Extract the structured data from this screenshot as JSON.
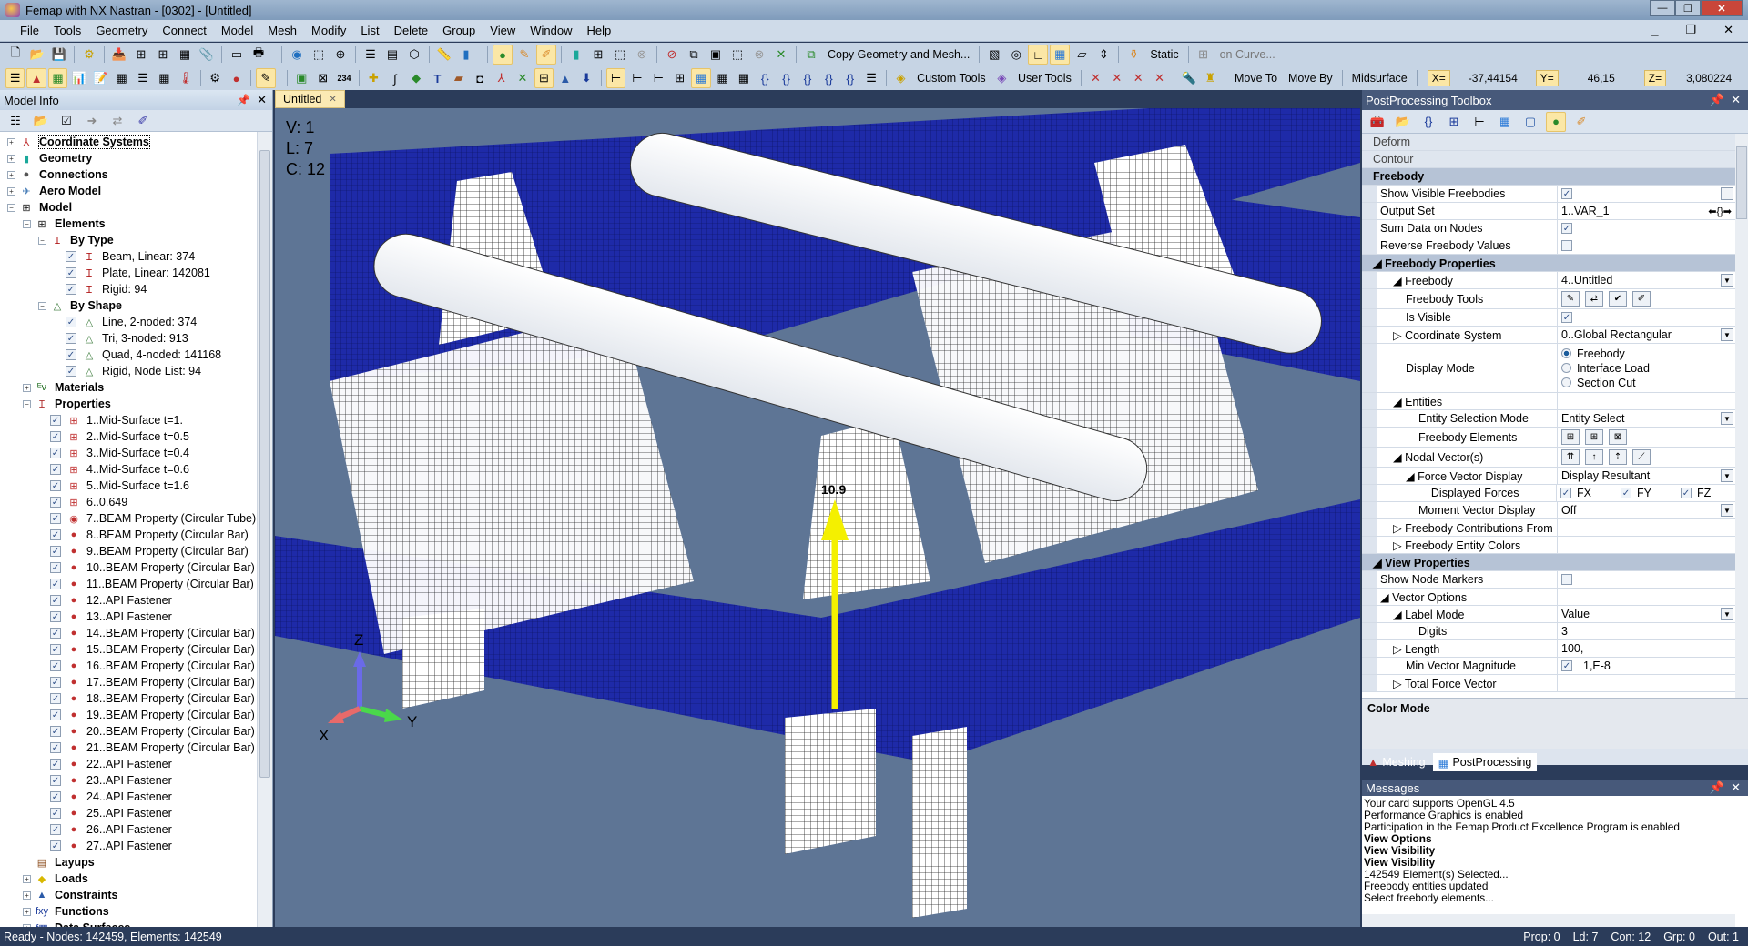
{
  "window": {
    "title": "Femap with NX Nastran - [0302] - [Untitled]",
    "min": "—",
    "restore": "❐",
    "close": "✕"
  },
  "menu": [
    "File",
    "Tools",
    "Geometry",
    "Connect",
    "Model",
    "Mesh",
    "Modify",
    "List",
    "Delete",
    "Group",
    "View",
    "Window",
    "Help"
  ],
  "toolbar": {
    "copy_geometry": "Copy Geometry and Mesh...",
    "static": "Static",
    "on_curve": "on Curve...",
    "custom_tools": "Custom Tools",
    "user_tools": "User Tools",
    "move_to": "Move To",
    "move_by": "Move By",
    "midsurface": "Midsurface",
    "x_label": "X=",
    "x_value": "-37,44154",
    "y_label": "Y=",
    "y_value": "46,15",
    "z_label": "Z=",
    "z_value": "3,080224"
  },
  "model_info": {
    "title": "Model Info",
    "tree": [
      {
        "label": "Coordinate Systems",
        "level": 0,
        "bold": true,
        "exp": "+",
        "icon": "coord-sys-icon",
        "glyph": "⅄",
        "color": "#c03030"
      },
      {
        "label": "Geometry",
        "level": 0,
        "bold": true,
        "exp": "+",
        "icon": "geometry-icon",
        "glyph": "▮",
        "color": "#1aa89a"
      },
      {
        "label": "Connections",
        "level": 0,
        "bold": true,
        "exp": "+",
        "icon": "connections-icon",
        "glyph": "●",
        "color": "#555"
      },
      {
        "label": "Aero Model",
        "level": 0,
        "bold": true,
        "exp": "+",
        "icon": "aero-icon",
        "glyph": "✈",
        "color": "#4a7fb8"
      },
      {
        "label": "Model",
        "level": 0,
        "bold": true,
        "exp": "−",
        "icon": "model-icon",
        "glyph": "⊞",
        "color": "#222"
      },
      {
        "label": "Elements",
        "level": 1,
        "bold": true,
        "exp": "−",
        "icon": "elements-icon",
        "glyph": "⊞",
        "color": "#222"
      },
      {
        "label": "By Type",
        "level": 2,
        "bold": true,
        "exp": "−",
        "icon": "by-type-icon",
        "glyph": "Ｉ",
        "color": "#b01818"
      },
      {
        "label": "Beam, Linear: 374",
        "level": 3,
        "check": true,
        "icon": "beam-icon",
        "glyph": "Ｉ",
        "color": "#b01818"
      },
      {
        "label": "Plate, Linear: 142081",
        "level": 3,
        "check": true,
        "icon": "plate-icon",
        "glyph": "Ｉ",
        "color": "#b01818"
      },
      {
        "label": "Rigid: 94",
        "level": 3,
        "check": true,
        "icon": "rigid-icon",
        "glyph": "Ｉ",
        "color": "#b01818"
      },
      {
        "label": "By Shape",
        "level": 2,
        "bold": true,
        "exp": "−",
        "icon": "by-shape-icon",
        "glyph": "△",
        "color": "#3a7a3a"
      },
      {
        "label": "Line, 2-noded: 374",
        "level": 3,
        "check": true,
        "icon": "shape-icon",
        "glyph": "△",
        "color": "#3a7a3a"
      },
      {
        "label": "Tri,  3-noded: 913",
        "level": 3,
        "check": true,
        "icon": "shape-icon",
        "glyph": "△",
        "color": "#3a7a3a"
      },
      {
        "label": "Quad, 4-noded: 141168",
        "level": 3,
        "check": true,
        "icon": "shape-icon",
        "glyph": "△",
        "color": "#3a7a3a"
      },
      {
        "label": "Rigid, Node List: 94",
        "level": 3,
        "check": true,
        "icon": "shape-icon",
        "glyph": "△",
        "color": "#3a7a3a"
      },
      {
        "label": "Materials",
        "level": 1,
        "bold": true,
        "exp": "+",
        "icon": "materials-icon",
        "glyph": "ᴱν",
        "color": "#1a6a1a"
      },
      {
        "label": "Properties",
        "level": 1,
        "bold": true,
        "exp": "−",
        "icon": "properties-icon",
        "glyph": "Ｉ",
        "color": "#b03030"
      },
      {
        "label": "1..Mid-Surface t=1.",
        "level": 2,
        "check": true,
        "icon": "plate-prop-icon",
        "glyph": "⊞",
        "color": "#c03030"
      },
      {
        "label": "2..Mid-Surface t=0.5",
        "level": 2,
        "check": true,
        "icon": "plate-prop-icon",
        "glyph": "⊞",
        "color": "#c03030"
      },
      {
        "label": "3..Mid-Surface t=0.4",
        "level": 2,
        "check": true,
        "icon": "plate-prop-icon",
        "glyph": "⊞",
        "color": "#c03030"
      },
      {
        "label": "4..Mid-Surface t=0.6",
        "level": 2,
        "check": true,
        "icon": "plate-prop-icon",
        "glyph": "⊞",
        "color": "#c03030"
      },
      {
        "label": "5..Mid-Surface t=1.6",
        "level": 2,
        "check": true,
        "icon": "plate-prop-icon",
        "glyph": "⊞",
        "color": "#c03030"
      },
      {
        "label": "6..0.649",
        "level": 2,
        "check": true,
        "icon": "plate-prop-icon",
        "glyph": "⊞",
        "color": "#c03030"
      },
      {
        "label": "7..BEAM Property (Circular Tube)",
        "level": 2,
        "check": true,
        "icon": "tube-prop-icon",
        "glyph": "◉",
        "color": "#c03030"
      },
      {
        "label": "8..BEAM Property (Circular Bar)",
        "level": 2,
        "check": true,
        "icon": "bar-prop-icon",
        "glyph": "●",
        "color": "#c03030"
      },
      {
        "label": "9..BEAM Property (Circular Bar)",
        "level": 2,
        "check": true,
        "icon": "bar-prop-icon",
        "glyph": "●",
        "color": "#c03030"
      },
      {
        "label": "10..BEAM Property (Circular Bar)",
        "level": 2,
        "check": true,
        "icon": "bar-prop-icon",
        "glyph": "●",
        "color": "#c03030"
      },
      {
        "label": "11..BEAM Property (Circular Bar)",
        "level": 2,
        "check": true,
        "icon": "bar-prop-icon",
        "glyph": "●",
        "color": "#c03030"
      },
      {
        "label": "12..API Fastener",
        "level": 2,
        "check": true,
        "icon": "bar-prop-icon",
        "glyph": "●",
        "color": "#c03030"
      },
      {
        "label": "13..API Fastener",
        "level": 2,
        "check": true,
        "icon": "bar-prop-icon",
        "glyph": "●",
        "color": "#c03030"
      },
      {
        "label": "14..BEAM Property (Circular Bar)",
        "level": 2,
        "check": true,
        "icon": "bar-prop-icon",
        "glyph": "●",
        "color": "#c03030"
      },
      {
        "label": "15..BEAM Property (Circular Bar)",
        "level": 2,
        "check": true,
        "icon": "bar-prop-icon",
        "glyph": "●",
        "color": "#c03030"
      },
      {
        "label": "16..BEAM Property (Circular Bar)",
        "level": 2,
        "check": true,
        "icon": "bar-prop-icon",
        "glyph": "●",
        "color": "#c03030"
      },
      {
        "label": "17..BEAM Property (Circular Bar)",
        "level": 2,
        "check": true,
        "icon": "bar-prop-icon",
        "glyph": "●",
        "color": "#c03030"
      },
      {
        "label": "18..BEAM Property (Circular Bar)",
        "level": 2,
        "check": true,
        "icon": "bar-prop-icon",
        "glyph": "●",
        "color": "#c03030"
      },
      {
        "label": "19..BEAM Property (Circular Bar)",
        "level": 2,
        "check": true,
        "icon": "bar-prop-icon",
        "glyph": "●",
        "color": "#c03030"
      },
      {
        "label": "20..BEAM Property (Circular Bar)",
        "level": 2,
        "check": true,
        "icon": "bar-prop-icon",
        "glyph": "●",
        "color": "#c03030"
      },
      {
        "label": "21..BEAM Property (Circular Bar)",
        "level": 2,
        "check": true,
        "icon": "bar-prop-icon",
        "glyph": "●",
        "color": "#c03030"
      },
      {
        "label": "22..API Fastener",
        "level": 2,
        "check": true,
        "icon": "bar-prop-icon",
        "glyph": "●",
        "color": "#c03030"
      },
      {
        "label": "23..API Fastener",
        "level": 2,
        "check": true,
        "icon": "bar-prop-icon",
        "glyph": "●",
        "color": "#c03030"
      },
      {
        "label": "24..API Fastener",
        "level": 2,
        "check": true,
        "icon": "bar-prop-icon",
        "glyph": "●",
        "color": "#c03030"
      },
      {
        "label": "25..API Fastener",
        "level": 2,
        "check": true,
        "icon": "bar-prop-icon",
        "glyph": "●",
        "color": "#c03030"
      },
      {
        "label": "26..API Fastener",
        "level": 2,
        "check": true,
        "icon": "bar-prop-icon",
        "glyph": "●",
        "color": "#c03030"
      },
      {
        "label": "27..API Fastener",
        "level": 2,
        "check": true,
        "icon": "bar-prop-icon",
        "glyph": "●",
        "color": "#c03030"
      },
      {
        "label": "Layups",
        "level": 1,
        "bold": true,
        "icon": "layups-icon",
        "glyph": "▤",
        "color": "#8a4a1a"
      },
      {
        "label": "Loads",
        "level": 1,
        "bold": true,
        "exp": "+",
        "icon": "loads-icon",
        "glyph": "◆",
        "color": "#d8b800"
      },
      {
        "label": "Constraints",
        "level": 1,
        "bold": true,
        "exp": "+",
        "icon": "constraints-icon",
        "glyph": "▲",
        "color": "#2a5aa8"
      },
      {
        "label": "Functions",
        "level": 1,
        "bold": true,
        "exp": "+",
        "icon": "functions-icon",
        "glyph": "fxy",
        "color": "#1a3a9a"
      },
      {
        "label": "Data Surfaces",
        "level": 1,
        "bold": true,
        "exp": "+",
        "icon": "data-surfaces-icon",
        "glyph": "f▦",
        "color": "#1a3a9a"
      }
    ]
  },
  "viewport": {
    "tab": "Untitled",
    "info": [
      "V: 1",
      "L: 7",
      "C: 12"
    ],
    "axes": {
      "x": "X",
      "y": "Y",
      "z": "Z"
    },
    "vector_label": "10.9"
  },
  "postprocessing": {
    "title": "PostProcessing Toolbox",
    "rows": [
      {
        "type": "cat",
        "name": "Deform"
      },
      {
        "type": "cat",
        "name": "Contour"
      },
      {
        "type": "sect",
        "name": "Freebody"
      },
      {
        "name": "Show Visible Freebodies",
        "indent": 0,
        "check": true,
        "extra": "..."
      },
      {
        "name": "Output Set",
        "indent": 0,
        "value": "1..VAR_1",
        "extra": "arrows"
      },
      {
        "name": "Sum Data on Nodes",
        "indent": 0,
        "check": true
      },
      {
        "name": "Reverse Freebody Values",
        "indent": 0,
        "check": false
      },
      {
        "type": "sect",
        "name": "◢ Freebody Properties"
      },
      {
        "name": "◢ Freebody",
        "indent": 1,
        "value": "4..Untitled",
        "dropdown": true
      },
      {
        "name": "Freebody Tools",
        "indent": 2,
        "tools": [
          "✎",
          "⇄",
          "✔",
          "✐"
        ]
      },
      {
        "name": "Is Visible",
        "indent": 2,
        "check": true
      },
      {
        "name": "▷ Coordinate System",
        "indent": 1,
        "value": "0..Global Rectangular",
        "dropdown": true
      },
      {
        "name": "Display Mode",
        "indent": 2,
        "radios": [
          {
            "label": "Freebody",
            "on": true
          },
          {
            "label": "Interface Load",
            "on": false
          },
          {
            "label": "Section Cut",
            "on": false
          }
        ]
      },
      {
        "name": "◢ Entities",
        "indent": 1
      },
      {
        "name": "Entity Selection Mode",
        "indent": 3,
        "value": "Entity Select",
        "dropdown": true
      },
      {
        "name": "Freebody Elements",
        "indent": 3,
        "tools": [
          "⊞",
          "⊞",
          "⊠"
        ]
      },
      {
        "name": "◢ Nodal Vector(s)",
        "indent": 1,
        "tools": [
          "⇈",
          "↑",
          "⇡",
          "⟋"
        ]
      },
      {
        "name": "◢ Force Vector Display",
        "indent": 2,
        "value": "Display Resultant",
        "dropdown": true
      },
      {
        "name": "Displayed Forces",
        "indent": 4,
        "forces": [
          "FX",
          "FY",
          "FZ"
        ]
      },
      {
        "name": "Moment Vector Display",
        "indent": 3,
        "value": "Off",
        "dropdown": true
      },
      {
        "name": "▷ Freebody Contributions From",
        "indent": 1
      },
      {
        "name": "▷ Freebody Entity Colors",
        "indent": 1
      },
      {
        "type": "sect",
        "name": "◢ View Properties"
      },
      {
        "name": "Show Node Markers",
        "indent": 0,
        "check": false
      },
      {
        "name": "◢ Vector Options",
        "indent": 0
      },
      {
        "name": "◢ Label Mode",
        "indent": 1,
        "value": "Value",
        "dropdown": true
      },
      {
        "name": "Digits",
        "indent": 3,
        "value": "3"
      },
      {
        "name": "▷ Length",
        "indent": 1,
        "value": "100,"
      },
      {
        "name": "Min Vector Magnitude",
        "indent": 2,
        "check": true,
        "value": "1,E-8"
      },
      {
        "name": "▷ Total Force Vector",
        "indent": 1
      }
    ],
    "color_mode": "Color Mode",
    "tabs": [
      "Meshing",
      "PostProcessing"
    ]
  },
  "messages": {
    "title": "Messages",
    "lines": [
      {
        "text": "Your card supports OpenGL 4.5",
        "bold": false
      },
      {
        "text": "Performance Graphics is enabled",
        "bold": false
      },
      {
        "text": "Participation in the Femap Product Excellence Program is enabled",
        "bold": false
      },
      {
        "text": "View Options",
        "bold": true
      },
      {
        "text": "View Visibility",
        "bold": true
      },
      {
        "text": "View Visibility",
        "bold": true
      },
      {
        "text": "142549 Element(s) Selected...",
        "bold": false
      },
      {
        "text": "Freebody entities updated",
        "bold": false
      },
      {
        "text": "Select freebody elements...",
        "bold": false
      }
    ]
  },
  "status": {
    "left": "Ready - Nodes: 142459,  Elements: 142549",
    "right": [
      "Prop: 0",
      "Ld: 7",
      "Con: 12",
      "Grp: 0",
      "Out: 1"
    ]
  }
}
